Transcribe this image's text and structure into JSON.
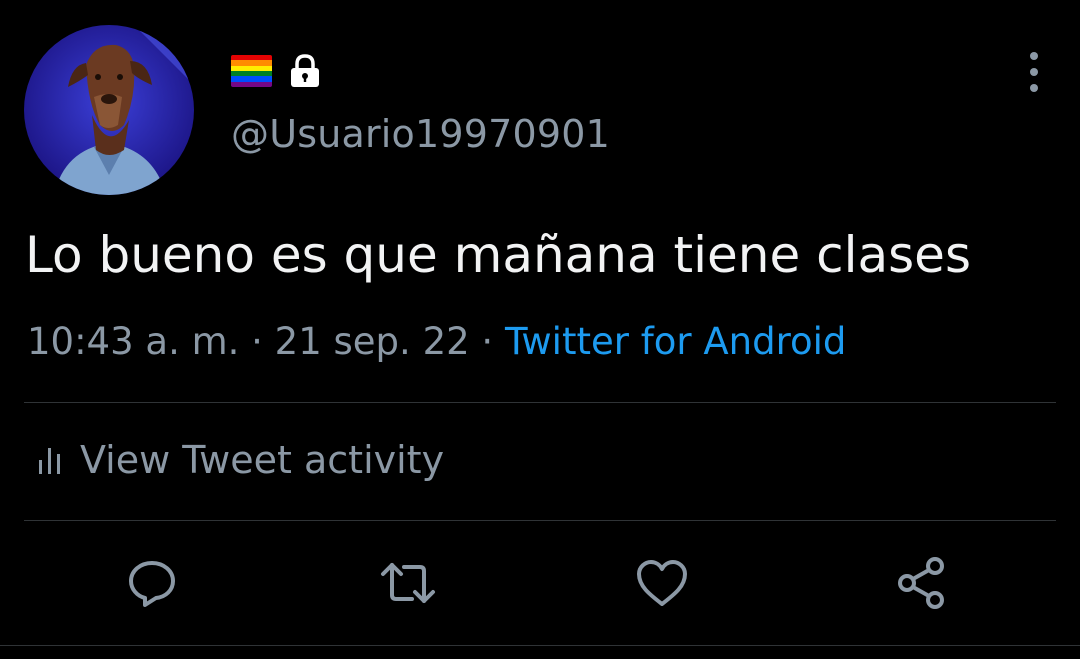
{
  "tweet": {
    "flag_colors": [
      "#e40303",
      "#ff8c00",
      "#ffed00",
      "#008026",
      "#004dff",
      "#750787"
    ],
    "handle": "@Usuario19970901",
    "text": "Lo bueno es que mañana tiene clases",
    "time_date": "10:43 a. m. · 21 sep. 22 · ",
    "source": "Twitter for Android",
    "activity_label": "View Tweet activity"
  },
  "colors": {
    "background": "#000000",
    "muted": "#8b98a5",
    "link": "#1d9bf0",
    "divider": "#2f3336"
  },
  "icons": {
    "more": "more-vertical-icon",
    "lock": "lock-icon",
    "activity": "bar-chart-icon",
    "reply": "reply-icon",
    "retweet": "retweet-icon",
    "like": "heart-icon",
    "share": "share-icon"
  }
}
